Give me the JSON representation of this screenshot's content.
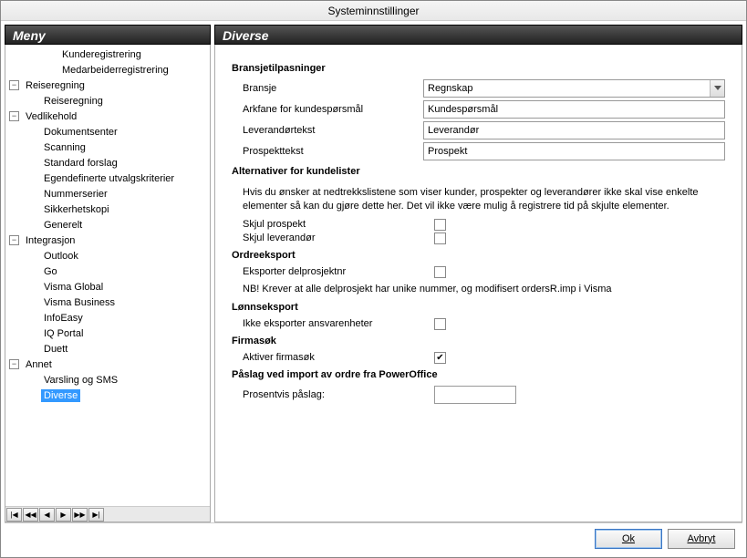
{
  "window": {
    "title": "Systeminnstillinger"
  },
  "left": {
    "header": "Meny"
  },
  "right": {
    "header": "Diverse"
  },
  "tree": {
    "items": [
      {
        "level": 3,
        "toggle": "",
        "label": "Kunderegistrering"
      },
      {
        "level": 3,
        "toggle": "",
        "label": "Medarbeiderregistrering"
      },
      {
        "level": 1,
        "toggle": "-",
        "label": "Reiseregning"
      },
      {
        "level": 2,
        "toggle": "",
        "label": "Reiseregning"
      },
      {
        "level": 1,
        "toggle": "-",
        "label": "Vedlikehold"
      },
      {
        "level": 2,
        "toggle": "",
        "label": "Dokumentsenter"
      },
      {
        "level": 2,
        "toggle": "",
        "label": "Scanning"
      },
      {
        "level": 2,
        "toggle": "",
        "label": "Standard forslag"
      },
      {
        "level": 2,
        "toggle": "",
        "label": "Egendefinerte utvalgskriterier"
      },
      {
        "level": 2,
        "toggle": "",
        "label": "Nummerserier"
      },
      {
        "level": 2,
        "toggle": "",
        "label": "Sikkerhetskopi"
      },
      {
        "level": 2,
        "toggle": "",
        "label": "Generelt"
      },
      {
        "level": 1,
        "toggle": "-",
        "label": "Integrasjon"
      },
      {
        "level": 2,
        "toggle": "",
        "label": "Outlook"
      },
      {
        "level": 2,
        "toggle": "",
        "label": "Go"
      },
      {
        "level": 2,
        "toggle": "",
        "label": "Visma Global"
      },
      {
        "level": 2,
        "toggle": "",
        "label": "Visma Business"
      },
      {
        "level": 2,
        "toggle": "",
        "label": "InfoEasy"
      },
      {
        "level": 2,
        "toggle": "",
        "label": "IQ Portal"
      },
      {
        "level": 2,
        "toggle": "",
        "label": "Duett"
      },
      {
        "level": 1,
        "toggle": "-",
        "label": "Annet"
      },
      {
        "level": 2,
        "toggle": "",
        "label": "Varsling og SMS"
      },
      {
        "level": 2,
        "toggle": "",
        "label": "Diverse",
        "selected": true
      }
    ]
  },
  "nav": [
    "|◀",
    "◀◀",
    "◀",
    "▶",
    "▶▶",
    "▶|"
  ],
  "content": {
    "bransje_section": "Bransjetilpasninger",
    "bransje_label": "Bransje",
    "bransje_value": "Regnskap",
    "arkfane_label": "Arkfane for kundespørsmål",
    "arkfane_value": "Kundespørsmål",
    "levtekst_label": "Leverandørtekst",
    "levtekst_value": "Leverandør",
    "prospekttekst_label": "Prospekttekst",
    "prospekttekst_value": "Prospekt",
    "alt_section": "Alternativer for kundelister",
    "alt_help": "Hvis du ønsker at nedtrekkslistene som viser kunder, prospekter og leverandører ikke skal vise enkelte elementer så kan du gjøre dette her. Det vil ikke være mulig å registrere tid på skjulte elementer.",
    "skjul_prospekt_label": "Skjul prospekt",
    "skjul_prospekt_checked": false,
    "skjul_lev_label": "Skjul leverandør",
    "skjul_lev_checked": false,
    "ordre_section": "Ordreeksport",
    "eksporter_del_label": "Eksporter delprosjektnr",
    "eksporter_del_checked": false,
    "ordre_note": "NB! Krever at alle delprosjekt har unike nummer, og modifisert ordersR.imp i Visma",
    "lonn_section": "Lønnseksport",
    "ikke_eksporter_label": "Ikke eksporter ansvarenheter",
    "ikke_eksporter_checked": false,
    "firmasok_section": "Firmasøk",
    "aktiver_firmasok_label": "Aktiver firmasøk",
    "aktiver_firmasok_checked": true,
    "paslag_section": "Påslag ved import av ordre fra PowerOffice",
    "prosentvis_label": "Prosentvis påslag:",
    "prosentvis_value": ""
  },
  "footer": {
    "ok": "Ok",
    "cancel": "Avbryt"
  }
}
